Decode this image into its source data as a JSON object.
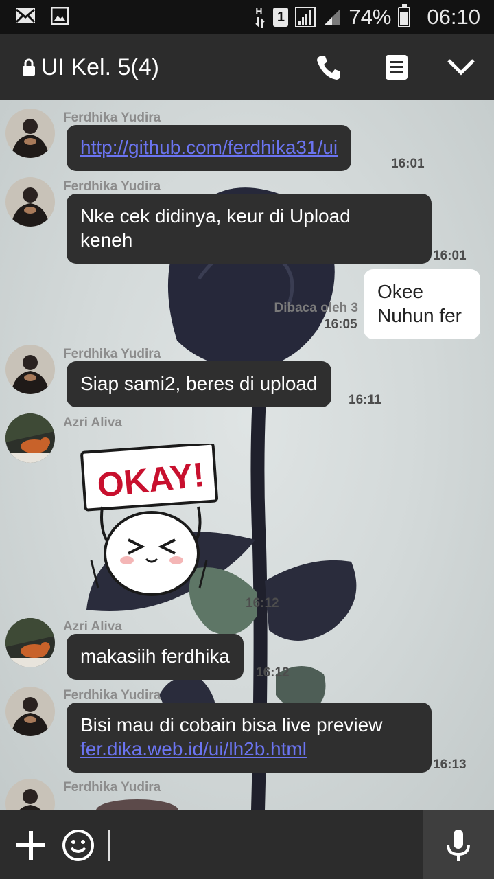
{
  "status_bar": {
    "network_type": "H",
    "sim_slot": "1",
    "battery": "74%",
    "battery_level": 0.74,
    "time": "06:10",
    "left_icons": [
      "mail-icon",
      "image-icon"
    ]
  },
  "header": {
    "title": "UI Kel. 5(4)",
    "icons": [
      "lock-icon",
      "phone-icon",
      "notes-icon",
      "chevron-down-icon"
    ]
  },
  "messages": [
    {
      "sender": "Ferdhika Yudira",
      "text": "http://github.com/ferdhika31/ui",
      "time": "16:01"
    },
    {
      "sender": "Ferdhika Yudira",
      "text_line1": "Nke cek didinya, keur di Upload",
      "text_line2": "keneh",
      "time": "16:01"
    },
    {
      "own": true,
      "text_line1": "Okee",
      "text_line2": "Nuhun fer",
      "read_by": "Dibaca oleh 3",
      "time": "16:05"
    },
    {
      "sender": "Ferdhika Yudira",
      "text": "Siap sami2, beres di upload",
      "time": "16:11"
    },
    {
      "sender": "Azri Aliva",
      "sticker": "okay-sticker",
      "sticker_text": "OKAY!",
      "time": "16:12"
    },
    {
      "sender": "Azri Aliva",
      "text": "makasiih ferdhika",
      "time": "16:12"
    },
    {
      "sender": "Ferdhika Yudira",
      "text_line1": "Bisi mau di cobain bisa live preview",
      "link": "fer.dika.web.id/ui/lh2b.html",
      "time": "16:13"
    },
    {
      "sender": "Ferdhika Yudira"
    }
  ],
  "input_bar": {
    "icons": [
      "plus-icon",
      "emoji-icon",
      "microphone-icon"
    ]
  },
  "colors": {
    "header_bg": "#2c2c2c",
    "incoming_bubble": "#2f2f2f",
    "outgoing_bubble": "#ffffff",
    "link": "#6b74f0"
  }
}
